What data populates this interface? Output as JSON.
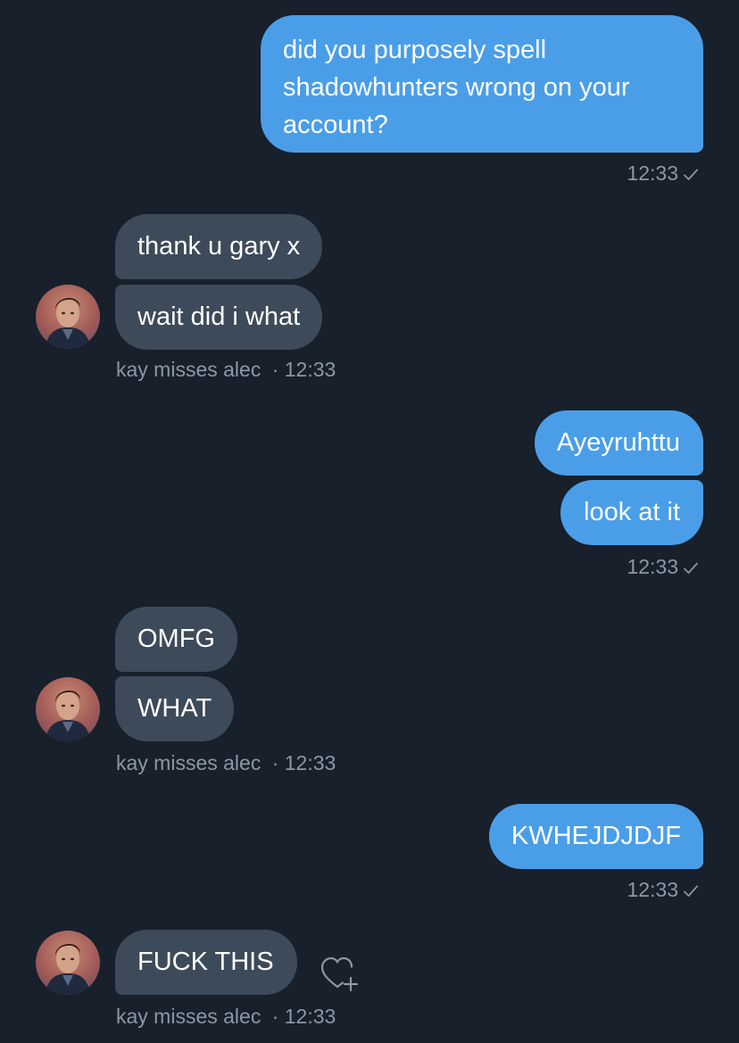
{
  "colors": {
    "background": "#17202b",
    "outgoing_bubble": "#4a9ee8",
    "incoming_bubble": "#3d4a59",
    "meta_text": "#8b98a5"
  },
  "messages": {
    "out1": {
      "line1": "did you purposely spell",
      "line2": "shadowhunters wrong on your",
      "line3": "account?",
      "time": "12:33"
    },
    "in1": {
      "text1": "thank u gary x",
      "text2": "wait did i what",
      "sender": "kay misses alec",
      "time": "· 12:33"
    },
    "out2": {
      "text1": "Ayeyruhttu",
      "text2": "look at it",
      "time": "12:33"
    },
    "in2": {
      "text1": "OMFG",
      "text2": "WHAT",
      "sender": "kay misses alec",
      "time": "· 12:33"
    },
    "out3": {
      "text1": "KWHEJDJDJF",
      "time": "12:33"
    },
    "in3": {
      "text1": "FUCK THIS",
      "sender": "kay misses alec",
      "time": "· 12:33"
    }
  },
  "icons": {
    "read_receipt": "checkmark-icon",
    "react": "heart-plus-icon",
    "avatar": "avatar"
  }
}
